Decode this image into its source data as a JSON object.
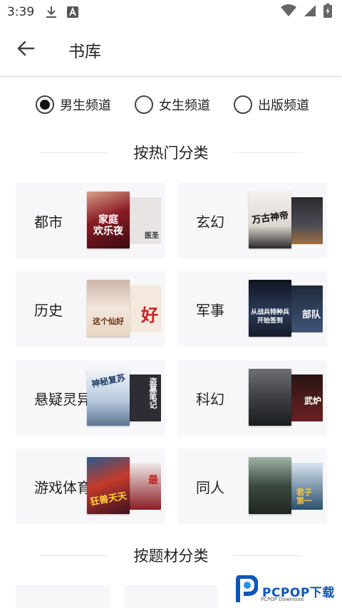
{
  "status_bar": {
    "time": "3:39"
  },
  "app_bar": {
    "title": "书库"
  },
  "channels": [
    {
      "label": "男生频道",
      "selected": true
    },
    {
      "label": "女生频道",
      "selected": false
    },
    {
      "label": "出版频道",
      "selected": false
    }
  ],
  "sections": {
    "hot": "按热门分类",
    "topic": "按题材分类"
  },
  "categories": [
    {
      "label": "都市",
      "front_color": "#7a1620",
      "back_color": "#e9e4e4",
      "front_text": "家庭\n欢乐夜",
      "back_text": "医圣"
    },
    {
      "label": "玄幻",
      "front_color": "#efeaea",
      "back_color": "#3b3b40",
      "front_text": "万古神帝",
      "back_text": ""
    },
    {
      "label": "历史",
      "front_color": "#f1e2d4",
      "back_color": "#f5e9dd",
      "front_text": "这个仙好",
      "back_text": "好"
    },
    {
      "label": "军事",
      "front_color": "#1f2a3c",
      "back_color": "#2c3a52",
      "front_text": "从战兵特种兵\n开始签到",
      "back_text": "部队"
    },
    {
      "label": "悬疑灵异",
      "front_color": "#b9cbe0",
      "back_color": "#2d2d33",
      "front_text": "神秘复苏",
      "back_text": "盗墓笔记"
    },
    {
      "label": "科幻",
      "front_color": "#3d3f44",
      "back_color": "#5b1e1e",
      "front_text": "",
      "back_text": "武炉"
    },
    {
      "label": "游戏体育",
      "front_color": "#4a1d2e",
      "back_color": "#7a1e22",
      "front_text": "狂兽天天",
      "back_text": "最"
    },
    {
      "label": "同人",
      "front_color": "#3b4a3f",
      "back_color": "#2b4f6e",
      "front_text": "",
      "back_text": "君子\n第一"
    }
  ],
  "watermark": {
    "text": "PCPOP下载",
    "sub": "PCPOP Download"
  }
}
